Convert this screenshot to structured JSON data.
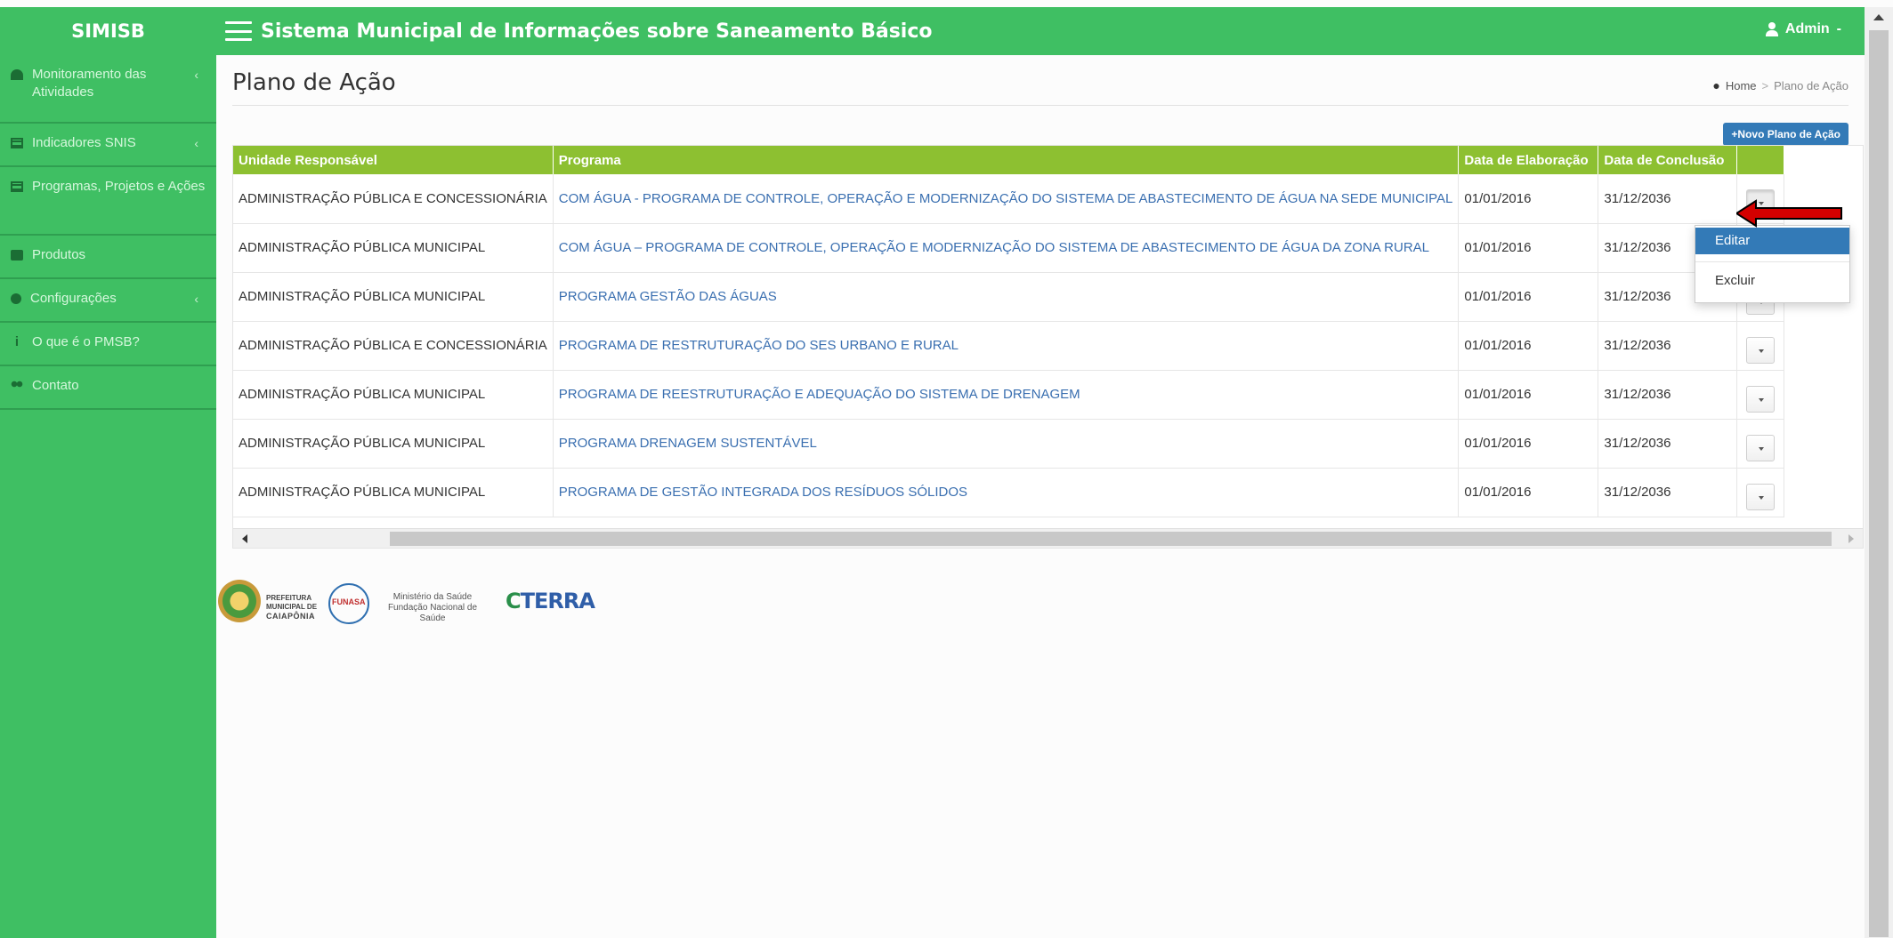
{
  "brand": {
    "title": "SIMISB"
  },
  "header": {
    "app_title": "Sistema Municipal de Informações sobre Saneamento Básico",
    "user_label": "Admin",
    "user_caret": "-"
  },
  "sidebar": {
    "items": [
      {
        "label": "Monitoramento das Atividades",
        "icon": "dashboard-icon",
        "has_chevron": true,
        "chevron": "‹"
      },
      {
        "label": "Indicadores SNIS",
        "icon": "table-icon",
        "has_chevron": true,
        "chevron": "‹"
      },
      {
        "label": "Programas, Projetos e Ações",
        "icon": "table-icon",
        "has_chevron": false
      },
      {
        "label": "Produtos",
        "icon": "folder-icon",
        "has_chevron": false
      },
      {
        "label": "Configurações",
        "icon": "gear-icon",
        "has_chevron": true,
        "chevron": "‹"
      },
      {
        "label": "O que é o PMSB?",
        "icon": "info-icon",
        "has_chevron": false
      },
      {
        "label": "Contato",
        "icon": "group-icon",
        "has_chevron": false
      }
    ]
  },
  "page": {
    "title": "Plano de Ação",
    "breadcrumb": {
      "home": "Home",
      "separator": ">",
      "current": "Plano de Ação"
    },
    "new_button": "+Novo Plano de Ação"
  },
  "table": {
    "columns": [
      "Unidade Responsável",
      "Programa",
      "Data de Elaboração",
      "Data de Conclusão",
      ""
    ],
    "rows": [
      {
        "unidade": "ADMINISTRAÇÃO PÚBLICA E CONCESSIONÁRIA",
        "programa": "COM ÁGUA - PROGRAMA DE CONTROLE, OPERAÇÃO E MODERNIZAÇÃO DO SISTEMA DE ABASTECIMENTO DE ÁGUA NA SEDE MUNICIPAL",
        "elaboracao": "01/01/2016",
        "conclusao": "31/12/2036"
      },
      {
        "unidade": "ADMINISTRAÇÃO PÚBLICA MUNICIPAL",
        "programa": "COM ÁGUA – PROGRAMA DE CONTROLE, OPERAÇÃO E MODERNIZAÇÃO DO SISTEMA DE ABASTECIMENTO DE ÁGUA DA ZONA RURAL",
        "elaboracao": "01/01/2016",
        "conclusao": "31/12/2036"
      },
      {
        "unidade": "ADMINISTRAÇÃO PÚBLICA MUNICIPAL",
        "programa": "PROGRAMA GESTÃO DAS ÁGUAS",
        "elaboracao": "01/01/2016",
        "conclusao": "31/12/2036"
      },
      {
        "unidade": "ADMINISTRAÇÃO PÚBLICA E CONCESSIONÁRIA",
        "programa": "PROGRAMA DE RESTRUTURAÇÃO DO SES URBANO E RURAL",
        "elaboracao": "01/01/2016",
        "conclusao": "31/12/2036"
      },
      {
        "unidade": "ADMINISTRAÇÃO PÚBLICA MUNICIPAL",
        "programa": "PROGRAMA DE REESTRUTURAÇÃO E ADEQUAÇÃO DO SISTEMA DE DRENAGEM",
        "elaboracao": "01/01/2016",
        "conclusao": "31/12/2036"
      },
      {
        "unidade": "ADMINISTRAÇÃO PÚBLICA MUNICIPAL",
        "programa": "PROGRAMA DRENAGEM SUSTENTÁVEL",
        "elaboracao": "01/01/2016",
        "conclusao": "31/12/2036"
      },
      {
        "unidade": "ADMINISTRAÇÃO PÚBLICA MUNICIPAL",
        "programa": "PROGRAMA DE GESTÃO INTEGRADA DOS RESÍDUOS SÓLIDOS",
        "elaboracao": "01/01/2016",
        "conclusao": "31/12/2036"
      }
    ]
  },
  "dropdown": {
    "edit": "Editar",
    "delete": "Excluir"
  },
  "logos": {
    "prefeitura_small": "PREFEITURA MUNICIPAL DE",
    "prefeitura_name": "CAIAPÔNIA",
    "funasa": "FUNASA",
    "ministerio": "Ministério da Saúde",
    "fundacao": "Fundação Nacional de Saúde",
    "terra": "TERRA"
  },
  "colors": {
    "brand_green": "#3fbf63",
    "table_header": "#8dc031",
    "primary_blue": "#337ab7",
    "link_blue": "#3a6fb0",
    "arrow_red": "#d40000"
  }
}
